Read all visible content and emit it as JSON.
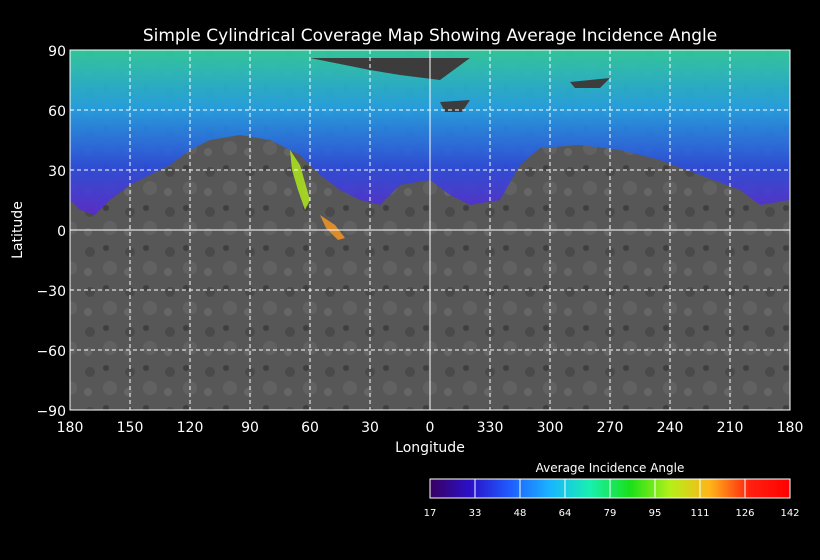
{
  "title": "Simple Cylindrical Coverage Map Showing Average Incidence Angle",
  "axes": {
    "x_label": "Longitude",
    "y_label": "Latitude",
    "x_ticks": [
      "180",
      "150",
      "120",
      "90",
      "60",
      "30",
      "0",
      "330",
      "300",
      "270",
      "240",
      "210",
      "180"
    ],
    "y_ticks": [
      "90",
      "60",
      "30",
      "0",
      "−30",
      "−60",
      "−90"
    ]
  },
  "colorbar": {
    "title": "Average Incidence Angle",
    "ticks": [
      "17",
      "33",
      "48",
      "64",
      "79",
      "95",
      "111",
      "126",
      "142"
    ],
    "colors": [
      "#3a0060",
      "#2a10c8",
      "#1f5cff",
      "#19b4ff",
      "#19f0b0",
      "#19e019",
      "#b4f019",
      "#ffb419",
      "#ff2010",
      "#ff0000"
    ]
  },
  "colors": {
    "background": "#000000",
    "basemap": "#565656",
    "grid": "#ffffff"
  }
}
